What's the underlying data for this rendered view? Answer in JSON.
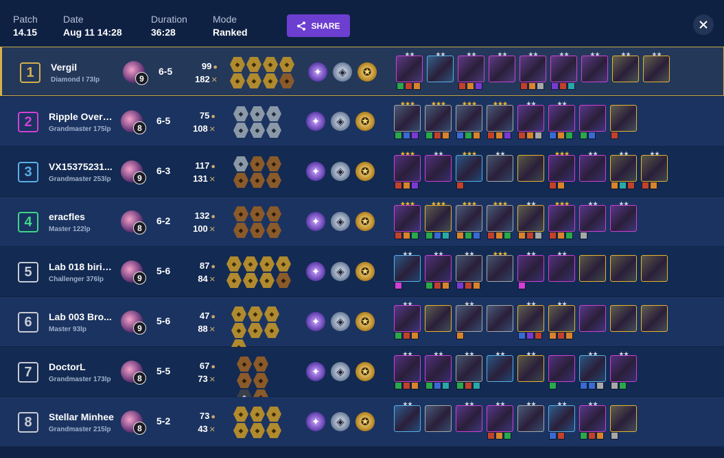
{
  "header": {
    "patch_label": "Patch",
    "patch_value": "14.15",
    "date_label": "Date",
    "date_value": "Aug 11 14:28",
    "duration_label": "Duration",
    "duration_value": "36:28",
    "mode_label": "Mode",
    "mode_value": "Ranked",
    "share_label": "SHARE",
    "share_icon": "share-icon",
    "close_icon": "close-icon"
  },
  "colors": {
    "accent": "#6c3fd1",
    "place_1": "#d4b14c",
    "place_2": "#d13fd6",
    "place_3": "#5ab0e8",
    "place_4": "#3fd68a",
    "place_other": "#c9ccd4",
    "gold_star": "#e8b430",
    "silver_star": "#c9d1dc"
  },
  "players": [
    {
      "place": "1",
      "name": "Vergil",
      "rank": "Diamond I 73lp",
      "level": "9",
      "stage": "6-5",
      "gold": "99",
      "damage": "182",
      "traits": [
        "gold",
        "gold",
        "gold",
        "gold",
        "gold",
        "gold",
        "gold",
        "bronze"
      ],
      "augments": [
        "p",
        "s",
        "g"
      ],
      "units": [
        {
          "border": "#d13fd6",
          "stars": "★★",
          "star_color": "silver",
          "items": [
            "#2aa84a",
            "#c2412a",
            "#d9832a"
          ]
        },
        {
          "border": "#5ab0e8",
          "stars": "★★",
          "star_color": "silver",
          "items": []
        },
        {
          "border": "#d13fd6",
          "stars": "★★",
          "star_color": "silver",
          "items": [
            "#c2412a",
            "#d9832a",
            "#7a3ad1"
          ]
        },
        {
          "border": "#d13fd6",
          "stars": "★★",
          "star_color": "silver",
          "items": []
        },
        {
          "border": "#d13fd6",
          "stars": "★★",
          "star_color": "silver",
          "items": [
            "#c2412a",
            "#d9832a",
            "#a8a8a8"
          ]
        },
        {
          "border": "#d13fd6",
          "stars": "★★",
          "star_color": "silver",
          "items": [
            "#7a3ad1",
            "#c2412a",
            "#2aa8a8"
          ]
        },
        {
          "border": "#d13fd6",
          "stars": "★★",
          "star_color": "silver",
          "items": []
        },
        {
          "border": "#e8b430",
          "stars": "★★",
          "star_color": "silver",
          "items": []
        },
        {
          "border": "#e8b430",
          "stars": "★★",
          "star_color": "silver",
          "items": []
        }
      ]
    },
    {
      "place": "2",
      "name": "Ripple Overd...",
      "rank": "Grandmaster 175lp",
      "level": "8",
      "stage": "6-5",
      "gold": "75",
      "damage": "108",
      "traits": [
        "silver",
        "silver",
        "silver",
        "silver",
        "silver",
        "silver"
      ],
      "augments": [
        "p",
        "s",
        "g"
      ],
      "units": [
        {
          "border": "#a8a8a8",
          "stars": "★★★",
          "star_color": "gold",
          "items": [
            "#2aa84a",
            "#3a6ad1",
            "#7a3ad1"
          ]
        },
        {
          "border": "#a8a8a8",
          "stars": "★★★",
          "star_color": "gold",
          "items": [
            "#2aa84a",
            "#c2412a",
            "#d9832a"
          ]
        },
        {
          "border": "#a8a8a8",
          "stars": "★★★",
          "star_color": "gold",
          "items": [
            "#3a6ad1",
            "#2aa84a",
            "#d9832a"
          ]
        },
        {
          "border": "#a8a8a8",
          "stars": "★★★",
          "star_color": "gold",
          "items": [
            "#c2412a",
            "#d9832a",
            "#7a3ad1"
          ]
        },
        {
          "border": "#d13fd6",
          "stars": "★★",
          "star_color": "silver",
          "items": [
            "#c2412a",
            "#d9832a",
            "#a8a8a8"
          ]
        },
        {
          "border": "#d13fd6",
          "stars": "★★",
          "star_color": "silver",
          "items": [
            "#3a6ad1",
            "#d9832a",
            "#2aa84a"
          ]
        },
        {
          "border": "#d13fd6",
          "stars": "",
          "star_color": "silver",
          "items": [
            "#2aa84a",
            "#3a6ad1"
          ]
        },
        {
          "border": "#e8b430",
          "stars": "",
          "star_color": "silver",
          "items": [
            "#c2412a"
          ]
        }
      ]
    },
    {
      "place": "3",
      "name": "VX15375231...",
      "rank": "Grandmaster 253lp",
      "level": "9",
      "stage": "6-3",
      "gold": "117",
      "damage": "131",
      "traits": [
        "silver",
        "bronze",
        "bronze",
        "bronze",
        "bronze",
        "bronze"
      ],
      "augments": [
        "p",
        "s",
        "g"
      ],
      "units": [
        {
          "border": "#d13fd6",
          "stars": "★★★",
          "star_color": "gold",
          "items": [
            "#c2412a",
            "#d9832a",
            "#7a3ad1"
          ]
        },
        {
          "border": "#d13fd6",
          "stars": "★★",
          "star_color": "silver",
          "items": []
        },
        {
          "border": "#5ab0e8",
          "stars": "★★★",
          "star_color": "gold",
          "items": [
            "#c2412a"
          ]
        },
        {
          "border": "#a8a8a8",
          "stars": "★★",
          "star_color": "silver",
          "items": []
        },
        {
          "border": "#e8b430",
          "stars": "",
          "star_color": "silver",
          "items": []
        },
        {
          "border": "#d13fd6",
          "stars": "★★★",
          "star_color": "gold",
          "items": [
            "#c2412a",
            "#d9832a"
          ]
        },
        {
          "border": "#d13fd6",
          "stars": "★★",
          "star_color": "silver",
          "items": []
        },
        {
          "border": "#e8b430",
          "stars": "★★",
          "star_color": "silver",
          "items": [
            "#d9832a",
            "#2aa8a8",
            "#c2412a"
          ]
        },
        {
          "border": "#e8b430",
          "stars": "★★",
          "star_color": "silver",
          "items": [
            "#c2412a",
            "#d9832a"
          ]
        }
      ]
    },
    {
      "place": "4",
      "name": "eracfles",
      "rank": "Master 122lp",
      "level": "8",
      "stage": "6-2",
      "gold": "132",
      "damage": "100",
      "traits": [
        "bronze",
        "bronze",
        "bronze",
        "bronze",
        "bronze",
        "bronze"
      ],
      "augments": [
        "p",
        "s",
        "g"
      ],
      "units": [
        {
          "border": "#d13fd6",
          "stars": "★★★",
          "star_color": "gold",
          "items": [
            "#c2412a",
            "#d9832a",
            "#2aa84a"
          ]
        },
        {
          "border": "#e8b430",
          "stars": "★★★",
          "star_color": "gold",
          "items": [
            "#2aa84a",
            "#3a6ad1",
            "#2aa8a8"
          ]
        },
        {
          "border": "#a8a8a8",
          "stars": "★★★",
          "star_color": "gold",
          "items": [
            "#d9832a",
            "#2aa84a",
            "#3a6ad1"
          ]
        },
        {
          "border": "#a8a8a8",
          "stars": "★★★",
          "star_color": "gold",
          "items": [
            "#c2412a",
            "#d9832a",
            "#2aa84a"
          ]
        },
        {
          "border": "#e8b430",
          "stars": "★★",
          "star_color": "silver",
          "items": [
            "#d9832a",
            "#c2412a",
            "#a8a8a8"
          ]
        },
        {
          "border": "#d13fd6",
          "stars": "★★★",
          "star_color": "gold",
          "items": [
            "#c2412a",
            "#d9832a",
            "#2aa84a"
          ]
        },
        {
          "border": "#d13fd6",
          "stars": "★★",
          "star_color": "silver",
          "items": [
            "#a8a8a8"
          ]
        },
        {
          "border": "#d13fd6",
          "stars": "★★",
          "star_color": "silver",
          "items": []
        }
      ]
    },
    {
      "place": "5",
      "name": "Lab 018 birib...",
      "rank": "Challenger 376lp",
      "level": "9",
      "stage": "5-6",
      "gold": "87",
      "damage": "84",
      "traits": [
        "gold",
        "gold",
        "gold",
        "gold",
        "gold",
        "gold",
        "gold",
        "bronze"
      ],
      "augments": [
        "p",
        "s",
        "g"
      ],
      "units": [
        {
          "border": "#5ab0e8",
          "stars": "★★",
          "star_color": "silver",
          "items": [
            "#d13fd6"
          ]
        },
        {
          "border": "#d13fd6",
          "stars": "★★",
          "star_color": "silver",
          "items": [
            "#2aa84a",
            "#c2412a",
            "#d9832a"
          ]
        },
        {
          "border": "#a8a8a8",
          "stars": "★★",
          "star_color": "silver",
          "items": [
            "#7a3ad1",
            "#c2412a",
            "#d9832a"
          ]
        },
        {
          "border": "#a8a8a8",
          "stars": "★★★",
          "star_color": "gold",
          "items": []
        },
        {
          "border": "#d13fd6",
          "stars": "★★",
          "star_color": "silver",
          "items": [
            "#d13fd6"
          ]
        },
        {
          "border": "#d13fd6",
          "stars": "★★",
          "star_color": "silver",
          "items": []
        },
        {
          "border": "#e8b430",
          "stars": "",
          "star_color": "silver",
          "items": []
        },
        {
          "border": "#e8b430",
          "stars": "",
          "star_color": "silver",
          "items": []
        },
        {
          "border": "#e8b430",
          "stars": "",
          "star_color": "silver",
          "items": []
        }
      ]
    },
    {
      "place": "6",
      "name": "Lab 003 Bro...",
      "rank": "Master 93lp",
      "level": "9",
      "stage": "5-6",
      "gold": "47",
      "damage": "88",
      "traits": [
        "gold",
        "gold",
        "gold",
        "gold",
        "gold",
        "gold",
        "gold"
      ],
      "augments": [
        "p",
        "s",
        "g"
      ],
      "units": [
        {
          "border": "#d13fd6",
          "stars": "★★",
          "star_color": "silver",
          "items": [
            "#2aa84a",
            "#c2412a",
            "#d9832a"
          ]
        },
        {
          "border": "#e8b430",
          "stars": "",
          "star_color": "silver",
          "items": []
        },
        {
          "border": "#a8a8a8",
          "stars": "★★",
          "star_color": "silver",
          "items": [
            "#d9832a"
          ]
        },
        {
          "border": "#a8a8a8",
          "stars": "",
          "star_color": "silver",
          "items": []
        },
        {
          "border": "#e8b430",
          "stars": "★★",
          "star_color": "silver",
          "items": [
            "#3a6ad1",
            "#7a3ad1",
            "#c2412a"
          ]
        },
        {
          "border": "#e8b430",
          "stars": "★★",
          "star_color": "silver",
          "items": [
            "#d9832a",
            "#c2412a",
            "#d9832a"
          ]
        },
        {
          "border": "#d13fd6",
          "stars": "",
          "star_color": "silver",
          "items": []
        },
        {
          "border": "#e8b430",
          "stars": "",
          "star_color": "silver",
          "items": []
        },
        {
          "border": "#e8b430",
          "stars": "",
          "star_color": "silver",
          "items": []
        }
      ]
    },
    {
      "place": "7",
      "name": "DoctorL",
      "rank": "Grandmaster 173lp",
      "level": "8",
      "stage": "5-5",
      "gold": "67",
      "damage": "73",
      "traits": [
        "bronze",
        "bronze",
        "bronze",
        "bronze",
        "dark",
        "bronze"
      ],
      "augments": [
        "p",
        "s",
        "g"
      ],
      "units": [
        {
          "border": "#d13fd6",
          "stars": "★★",
          "star_color": "silver",
          "items": [
            "#2aa84a",
            "#c2412a",
            "#d9832a"
          ]
        },
        {
          "border": "#d13fd6",
          "stars": "★★",
          "star_color": "silver",
          "items": [
            "#2aa84a",
            "#3a6ad1",
            "#2aa8a8"
          ]
        },
        {
          "border": "#a8a8a8",
          "stars": "★★",
          "star_color": "silver",
          "items": [
            "#2aa84a",
            "#c2412a",
            "#2aa8a8"
          ]
        },
        {
          "border": "#5ab0e8",
          "stars": "★★",
          "star_color": "silver",
          "items": []
        },
        {
          "border": "#e8b430",
          "stars": "★★",
          "star_color": "silver",
          "items": []
        },
        {
          "border": "#d13fd6",
          "stars": "",
          "star_color": "silver",
          "items": [
            "#2aa84a"
          ]
        },
        {
          "border": "#5ab0e8",
          "stars": "★★",
          "star_color": "silver",
          "items": [
            "#3a6ad1",
            "#3a6ad1",
            "#a8a8a8"
          ]
        },
        {
          "border": "#d13fd6",
          "stars": "★★",
          "star_color": "silver",
          "items": [
            "#a8a8a8",
            "#2aa84a"
          ]
        }
      ]
    },
    {
      "place": "8",
      "name": "Stellar Minhee",
      "rank": "Grandmaster 215lp",
      "level": "8",
      "stage": "5-2",
      "gold": "73",
      "damage": "43",
      "traits": [
        "gold",
        "gold",
        "gold",
        "gold",
        "gold",
        "gold"
      ],
      "augments": [
        "p",
        "s",
        "g"
      ],
      "units": [
        {
          "border": "#5ab0e8",
          "stars": "★★",
          "star_color": "silver",
          "items": []
        },
        {
          "border": "#a8a8a8",
          "stars": "",
          "star_color": "silver",
          "items": []
        },
        {
          "border": "#d13fd6",
          "stars": "★★",
          "star_color": "silver",
          "items": []
        },
        {
          "border": "#d13fd6",
          "stars": "★★",
          "star_color": "silver",
          "items": [
            "#c2412a",
            "#d9832a",
            "#2aa84a"
          ]
        },
        {
          "border": "#a8a8a8",
          "stars": "★★",
          "star_color": "silver",
          "items": []
        },
        {
          "border": "#5ab0e8",
          "stars": "★★",
          "star_color": "silver",
          "items": [
            "#3a6ad1",
            "#c2412a"
          ]
        },
        {
          "border": "#d13fd6",
          "stars": "★★",
          "star_color": "silver",
          "items": [
            "#2aa84a",
            "#c2412a",
            "#d9832a"
          ]
        },
        {
          "border": "#e8b430",
          "stars": "",
          "star_color": "silver",
          "items": [
            "#a8a8a8"
          ]
        }
      ]
    }
  ]
}
